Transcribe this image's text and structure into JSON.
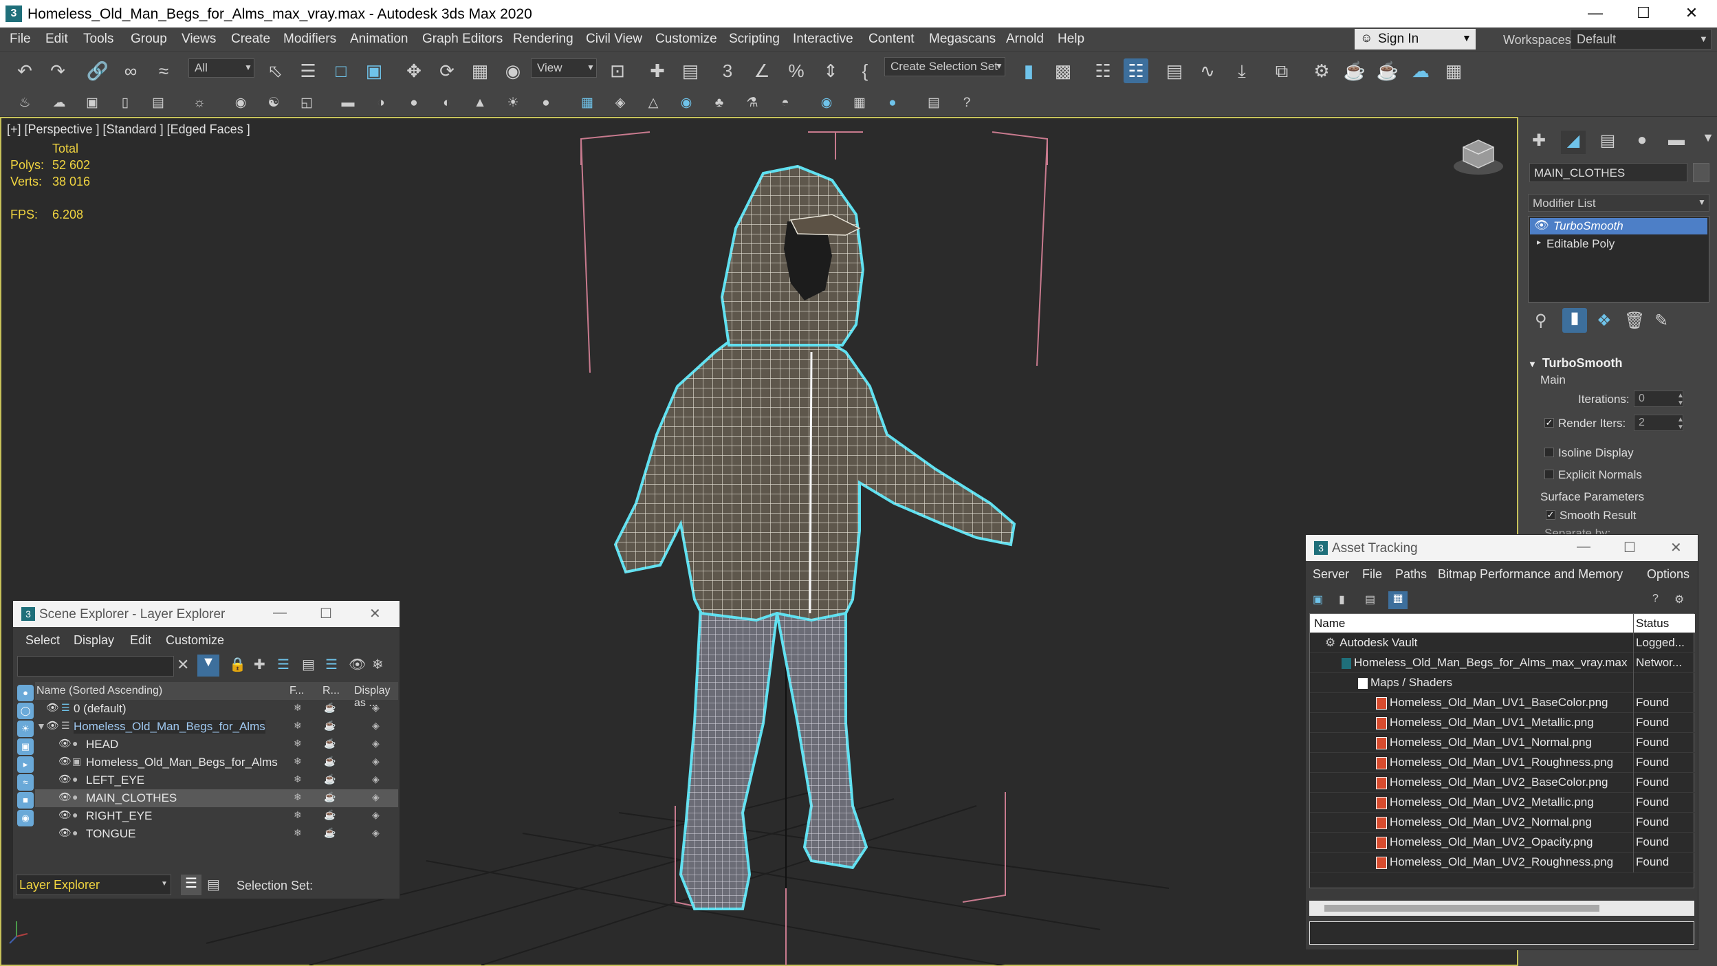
{
  "window": {
    "title": "Homeless_Old_Man_Begs_for_Alms_max_vray.max - Autodesk 3ds Max 2020",
    "app_icon": "3"
  },
  "menu": [
    "File",
    "Edit",
    "Tools",
    "Group",
    "Views",
    "Create",
    "Modifiers",
    "Animation",
    "Graph Editors",
    "Rendering",
    "Civil View",
    "Customize",
    "Scripting",
    "Interactive",
    "Content",
    "Megascans",
    "Arnold",
    "Help"
  ],
  "signin": {
    "label": "Sign In"
  },
  "workspaces": {
    "label": "Workspaces:",
    "value": "Default"
  },
  "toolbar": {
    "filter": "All",
    "refcoord": "View",
    "selection_set": "Create Selection Set"
  },
  "viewport": {
    "label": "[+] [Perspective ] [Standard ] [Edged Faces ]",
    "stats": {
      "total": "Total",
      "polys_label": "Polys:",
      "polys": "52 602",
      "verts_label": "Verts:",
      "verts": "38 016",
      "fps_label": "FPS:",
      "fps": "6.208"
    }
  },
  "command_panel": {
    "object_name": "MAIN_CLOTHES",
    "modifier_list": "Modifier List",
    "stack": [
      "TurboSmooth",
      "Editable Poly"
    ],
    "rollout_title": "TurboSmooth",
    "main_label": "Main",
    "iterations_label": "Iterations:",
    "iterations": "0",
    "render_iters_label": "Render Iters:",
    "render_iters": "2",
    "isoline": "Isoline Display",
    "explicit_normals": "Explicit Normals",
    "surface_params": "Surface Parameters",
    "smooth_result": "Smooth Result",
    "separate_by": "Separate by:"
  },
  "scene_explorer": {
    "title": "Scene Explorer - Layer Explorer",
    "menu": [
      "Select",
      "Display",
      "Edit",
      "Customize"
    ],
    "columns": {
      "name": "Name (Sorted Ascending)",
      "f": "F...",
      "r": "R...",
      "display": "Display as ..."
    },
    "rows": [
      {
        "name": "0 (default)",
        "indent": 1
      },
      {
        "name": "Homeless_Old_Man_Begs_for_Alms",
        "indent": 1
      },
      {
        "name": "HEAD",
        "indent": 2
      },
      {
        "name": "Homeless_Old_Man_Begs_for_Alms",
        "indent": 2
      },
      {
        "name": "LEFT_EYE",
        "indent": 2
      },
      {
        "name": "MAIN_CLOTHES",
        "indent": 2
      },
      {
        "name": "RIGHT_EYE",
        "indent": 2
      },
      {
        "name": "TONGUE",
        "indent": 2
      }
    ],
    "footer_layer": "Layer Explorer",
    "footer_selset": "Selection Set:"
  },
  "asset_tracking": {
    "title": "Asset Tracking",
    "menu": [
      "Server",
      "File",
      "Paths",
      "Bitmap Performance and Memory",
      "Options"
    ],
    "col_name": "Name",
    "col_status": "Status",
    "rows": [
      {
        "name": "Autodesk Vault",
        "status": "Logged...",
        "level": 0
      },
      {
        "name": "Homeless_Old_Man_Begs_for_Alms_max_vray.max",
        "status": "Networ...",
        "level": 1
      },
      {
        "name": "Maps / Shaders",
        "status": "",
        "level": 2
      },
      {
        "name": "Homeless_Old_Man_UV1_BaseColor.png",
        "status": "Found",
        "level": 3
      },
      {
        "name": "Homeless_Old_Man_UV1_Metallic.png",
        "status": "Found",
        "level": 3
      },
      {
        "name": "Homeless_Old_Man_UV1_Normal.png",
        "status": "Found",
        "level": 3
      },
      {
        "name": "Homeless_Old_Man_UV1_Roughness.png",
        "status": "Found",
        "level": 3
      },
      {
        "name": "Homeless_Old_Man_UV2_BaseColor.png",
        "status": "Found",
        "level": 3
      },
      {
        "name": "Homeless_Old_Man_UV2_Metallic.png",
        "status": "Found",
        "level": 3
      },
      {
        "name": "Homeless_Old_Man_UV2_Normal.png",
        "status": "Found",
        "level": 3
      },
      {
        "name": "Homeless_Old_Man_UV2_Opacity.png",
        "status": "Found",
        "level": 3
      },
      {
        "name": "Homeless_Old_Man_UV2_Roughness.png",
        "status": "Found",
        "level": 3
      }
    ]
  },
  "colors": {
    "accent": "#4d7fc7",
    "selection_outline": "#5fe0f0",
    "viewport_border": "#c7c25a",
    "stats_text": "#f0d440"
  }
}
